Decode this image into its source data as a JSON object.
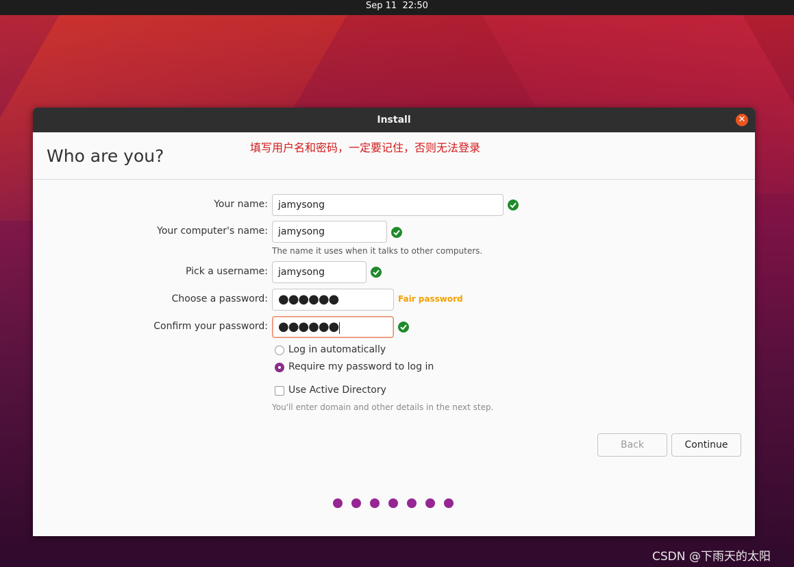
{
  "topbar": {
    "date": "Sep 11",
    "time": "22:50"
  },
  "window": {
    "title": "Install"
  },
  "page": {
    "title": "Who are you?",
    "annotation": "填写用户名和密码，一定要记住，否则无法登录"
  },
  "form": {
    "your_name": {
      "label": "Your name:",
      "value": "jamysong"
    },
    "computer_name": {
      "label": "Your computer's name:",
      "value": "jamysong",
      "hint": "The name it uses when it talks to other computers."
    },
    "username": {
      "label": "Pick a username:",
      "value": "jamysong"
    },
    "password": {
      "label": "Choose a password:",
      "value": "●●●●●●",
      "strength": "Fair password"
    },
    "confirm": {
      "label": "Confirm your password:",
      "value": "●●●●●●"
    }
  },
  "options": {
    "login_auto": {
      "label": "Log in automatically",
      "selected": false
    },
    "require_password": {
      "label": "Require my password to log in",
      "selected": true
    },
    "active_directory": {
      "label": "Use Active Directory",
      "checked": false,
      "hint": "You'll enter domain and other details in the next step."
    }
  },
  "buttons": {
    "back": "Back",
    "continue": "Continue"
  },
  "progress": {
    "steps": 7
  },
  "colors": {
    "accent": "#962693",
    "close": "#e95420",
    "ok": "#1f8a2b",
    "strength": "#f4a000"
  },
  "watermark": "CSDN @下雨天的太阳"
}
